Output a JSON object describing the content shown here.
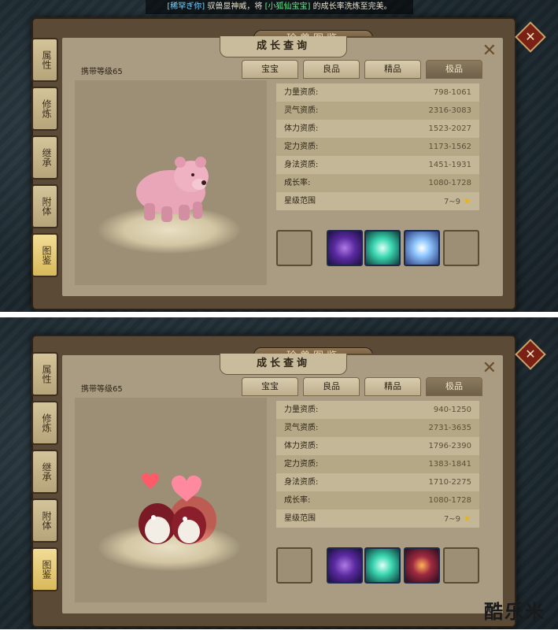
{
  "notice": {
    "player": "[稀罕ぎ你]",
    "text1": " 驭兽显神威，将 ",
    "pet": "[小狐仙宝宝]",
    "text2": " 的成长率洗炼至完美。"
  },
  "panels": [
    {
      "outer_title": "珍兽图鉴",
      "inner_title": "成长查询",
      "close": "✕",
      "carry": "携带等级65",
      "sidebar": [
        "属性",
        "修炼",
        "继承",
        "附体",
        "图鉴"
      ],
      "tabs": [
        "宝宝",
        "良品",
        "精品",
        "极品"
      ],
      "active_tab": "极品",
      "stats": [
        {
          "label": "力量资质:",
          "value": "798-1061"
        },
        {
          "label": "灵气资质:",
          "value": "2316-3083"
        },
        {
          "label": "体力资质:",
          "value": "1523-2027"
        },
        {
          "label": "定力资质:",
          "value": "1173-1562"
        },
        {
          "label": "身法资质:",
          "value": "1451-1931"
        },
        {
          "label": "成长率:",
          "value": "1080-1728"
        },
        {
          "label": "星级范围",
          "value": "7~9"
        }
      ],
      "skills": [
        "vortex-skill-icon",
        "swirl-skill-icon",
        "lightning-skill-icon"
      ]
    },
    {
      "outer_title": "珍兽图鉴",
      "inner_title": "成长查询",
      "close": "✕",
      "carry": "携带等级65",
      "sidebar": [
        "属性",
        "修炼",
        "继承",
        "附体",
        "图鉴"
      ],
      "tabs": [
        "宝宝",
        "良品",
        "精品",
        "极品"
      ],
      "active_tab": "极品",
      "stats": [
        {
          "label": "力量资质:",
          "value": "940-1250"
        },
        {
          "label": "灵气资质:",
          "value": "2731-3635"
        },
        {
          "label": "体力资质:",
          "value": "1796-2390"
        },
        {
          "label": "定力资质:",
          "value": "1383-1841"
        },
        {
          "label": "身法资质:",
          "value": "1710-2275"
        },
        {
          "label": "成长率:",
          "value": "1080-1728"
        },
        {
          "label": "星级范围",
          "value": "7~9"
        }
      ],
      "skills": [
        "vortex-skill-icon",
        "swirl-skill-icon",
        "demon-skill-icon"
      ]
    }
  ],
  "watermark": "酷乐米",
  "colors": {
    "accent": "#e8b418",
    "frame": "#5a4a36",
    "skill_border": "#1d2a4a"
  }
}
